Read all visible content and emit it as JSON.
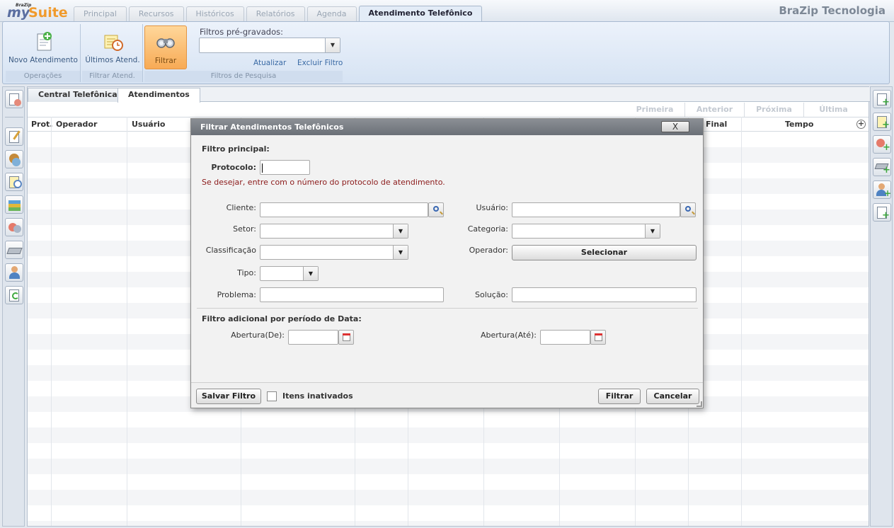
{
  "app": {
    "logo_top": "BraZip",
    "logo_my": "my",
    "logo_suite": "Suite",
    "company": "BraZip Tecnologia"
  },
  "nav_tabs": [
    "Principal",
    "Recursos",
    "Históricos",
    "Relatórios",
    "Agenda",
    "Atendimento Telefônico"
  ],
  "ribbon": {
    "operacoes_label": "Operações",
    "novo_atendimento": "Novo Atendimento",
    "filtrar_atend_label": "Filtrar Atend.",
    "ultimos_atend": "Últimos Atend.",
    "filtros_pesquisa_label": "Filtros de Pesquisa",
    "filtrar": "Filtrar",
    "prefilters_label": "Filtros pré-gravados:",
    "prefilters_value": "",
    "atualizar": "Atualizar",
    "excluir_filtro": "Excluir Filtro"
  },
  "subtabs": [
    "Central Telefônica",
    "Atendimentos"
  ],
  "pager": [
    "Primeira",
    "Anterior",
    "Próxima",
    "Última"
  ],
  "columns": {
    "prot": "Prot.",
    "operador": "Operador",
    "usuario": "Usuário",
    "final": "Final",
    "tempo": "Tempo"
  },
  "dialog": {
    "title": "Filtrar Atendimentos Telefônicos",
    "close": "X",
    "main_filter": "Filtro principal:",
    "protocolo_label": "Protocolo:",
    "protocolo_value": "",
    "hint": "Se desejar, entre com o número do protocolo de atendimento.",
    "cliente_label": "Cliente:",
    "usuario_label": "Usuário:",
    "setor_label": "Setor:",
    "categoria_label": "Categoria:",
    "classificacao_label": "Classificação",
    "operador_label": "Operador:",
    "selecionar": "Selecionar",
    "tipo_label": "Tipo:",
    "problema_label": "Problema:",
    "solucao_label": "Solução:",
    "date_filter": "Filtro adicional por período de Data:",
    "abertura_de": "Abertura(De):",
    "abertura_ate": "Abertura(Até):",
    "salvar_filtro": "Salvar Filtro",
    "itens_inativados": "Itens inativados",
    "filtrar": "Filtrar",
    "cancelar": "Cancelar"
  }
}
